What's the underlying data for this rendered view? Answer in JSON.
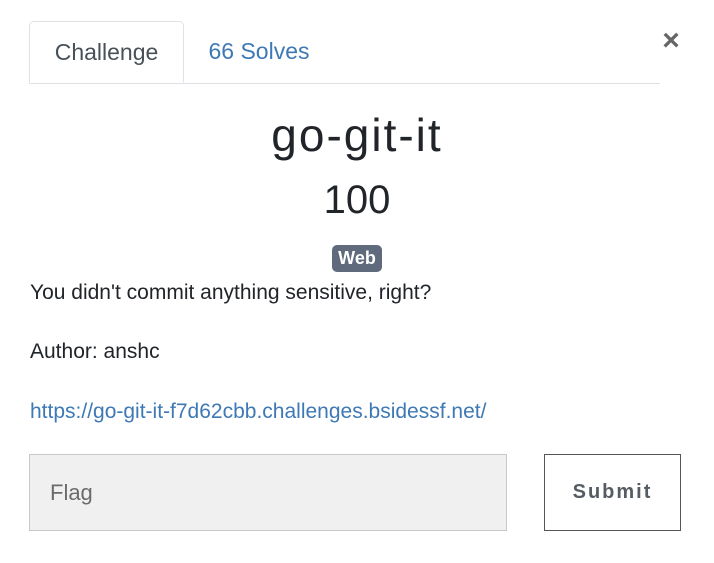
{
  "tabs": {
    "challenge": "Challenge",
    "solves": "66 Solves"
  },
  "close_icon": "×",
  "challenge": {
    "name": "go-git-it",
    "value": "100",
    "category": "Web",
    "description_line1": "You didn't commit anything sensitive, right?",
    "description_line2": "Author: anshc",
    "url": "https://go-git-it-f7d62cbb.challenges.bsidessf.net/"
  },
  "flag_form": {
    "placeholder": "Flag",
    "value": "",
    "submit_label": "Submit"
  },
  "colors": {
    "link": "#3e79b5",
    "badge": "#5f6b7d",
    "input_bg": "#f0f0f0"
  }
}
